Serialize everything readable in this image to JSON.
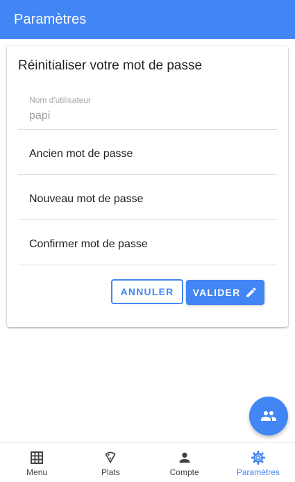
{
  "topbar": {
    "title": "Paramètres"
  },
  "card": {
    "title": "Réinitialiser votre mot de passe",
    "username": {
      "label": "Nom d'utilisateur",
      "value": "papi"
    },
    "old_password": {
      "label": "Ancien mot de passe"
    },
    "new_password": {
      "label": "Nouveau mot de passe"
    },
    "confirm_password": {
      "label": "Confirmer mot de passe"
    },
    "cancel_label": "ANNULER",
    "submit_label": "VALIDER"
  },
  "fab": {
    "icon": "people-icon"
  },
  "bottom_nav": {
    "items": [
      {
        "label": "Menu",
        "icon": "grid-icon",
        "active": false
      },
      {
        "label": "Plats",
        "icon": "pizza-icon",
        "active": false
      },
      {
        "label": "Compte",
        "icon": "person-icon",
        "active": false
      },
      {
        "label": "Paramètres",
        "icon": "gear-icon",
        "active": true
      }
    ]
  },
  "colors": {
    "primary": "#4285f4",
    "text": "#212121",
    "muted": "#9e9e9e"
  }
}
